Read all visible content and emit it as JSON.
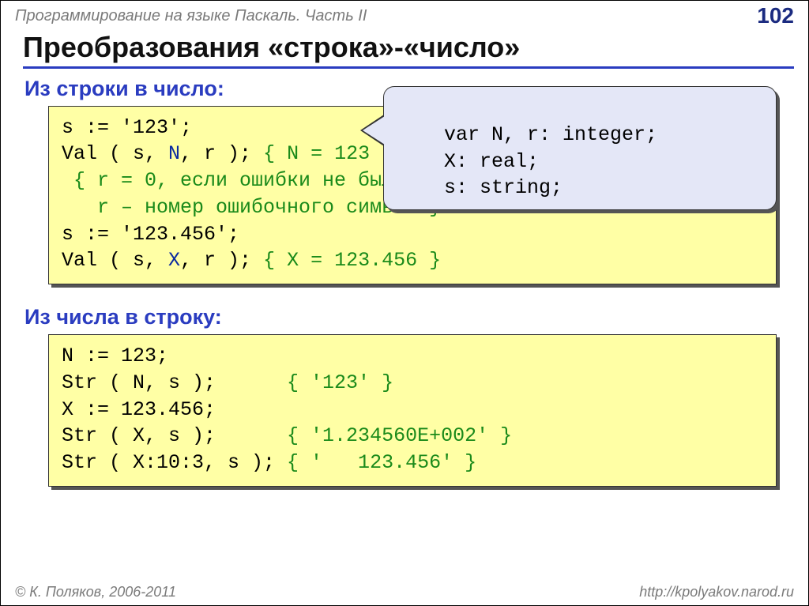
{
  "header": {
    "course": "Программирование на языке Паскаль. Часть II",
    "page": "102"
  },
  "title": "Преобразования «строка»-«число»",
  "section1": "Из строки в число:",
  "code1": {
    "l1": "s := '123';",
    "l2a": "Val ( s, ",
    "l2b": "N",
    "l2c": ", r );",
    "l2d": " { N = 123 }",
    "l3": " { r = 0, если ошибки не было",
    "l4": "   r – номер ошибочного символа}",
    "l5": "s := '123.456';",
    "l6a": "Val ( s, ",
    "l6b": "X",
    "l6c": ", r );",
    "l6d": " { X = 123.456 }"
  },
  "varbox": {
    "l1": "var N, r: integer;",
    "l2": "    X: real;",
    "l3": "    s: string;"
  },
  "section2": "Из числа в строку:",
  "code2": {
    "l1": "N := 123;",
    "l2a": "Str ( N, s );      ",
    "l2b": "{ '123' }",
    "l3": "X := 123.456;",
    "l4a": "Str ( X, s );      ",
    "l4b": "{ '1.234560E+002' }",
    "l5a": "Str ( X:10:3, s ); ",
    "l5b": "{ '   123.456' }"
  },
  "footer": {
    "left": "© К. Поляков, 2006-2011",
    "right": "http://kpolyakov.narod.ru"
  }
}
